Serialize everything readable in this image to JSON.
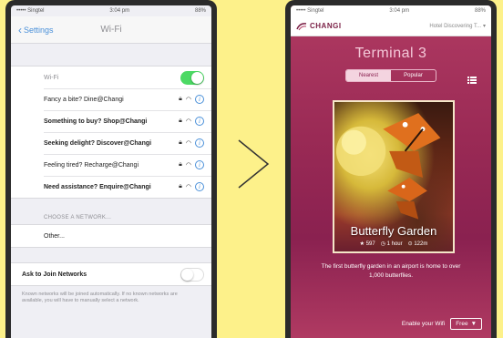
{
  "left": {
    "status": {
      "carrier": "••••• Singtel",
      "time": "3:04 pm",
      "battery": "88%"
    },
    "nav": {
      "back_label": "Settings",
      "title": "Wi-Fi"
    },
    "wifi_label": "Wi-Fi",
    "networks": [
      {
        "name": "Fancy a bite? Dine@Changi"
      },
      {
        "name": "Something to buy? Shop@Changi"
      },
      {
        "name": "Seeking delight? Discover@Changi"
      },
      {
        "name": "Feeling tired? Recharge@Changi"
      },
      {
        "name": "Need assistance? Enquire@Changi"
      }
    ],
    "choose_header": "CHOOSE A NETWORK...",
    "other_label": "Other...",
    "ask_label": "Ask to Join Networks",
    "footer_note": "Known networks will be joined automatically. If no known networks are available, you will have to manually select a network."
  },
  "right": {
    "status": {
      "carrier": "••••• Singtel",
      "time": "3:04 pm",
      "battery": "88%"
    },
    "brand": "CHANGI",
    "location_dropdown": "Hotel Discovering T...",
    "terminal_title": "Terminal 3",
    "tabs": [
      {
        "label": "Nearest"
      },
      {
        "label": "Popular"
      }
    ],
    "card": {
      "title": "Butterfly Garden",
      "rating": "597",
      "duration": "1 hour",
      "distance": "122m"
    },
    "description": "The first butterfly garden in an airport is home to over 1,000 butterflies.",
    "enable_label": "Enable your Wifi",
    "free_button": "Free"
  },
  "colors": {
    "background": "#fdf18a",
    "accent_magenta": "#9a2a55",
    "ios_green": "#4cd964",
    "ios_blue": "#4a90d9"
  }
}
